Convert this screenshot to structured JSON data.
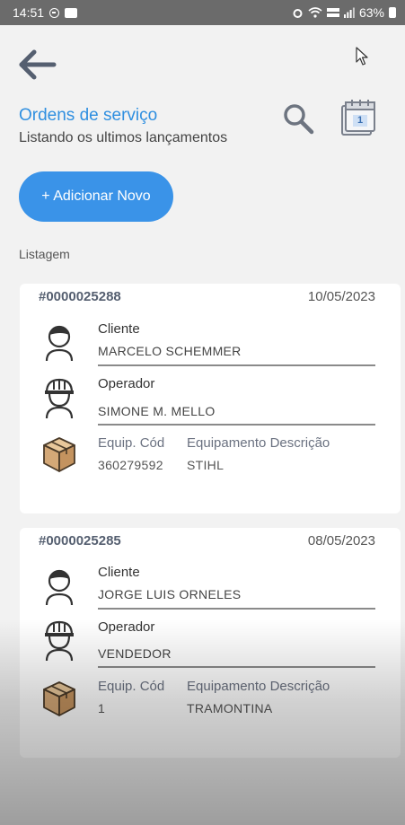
{
  "status_bar": {
    "time": "14:51",
    "battery": "63%"
  },
  "header": {
    "title": "Ordens de serviço",
    "subtitle": "Listando os ultimos lançamentos",
    "back_icon": "arrow-left-icon",
    "search_icon": "search-icon",
    "calendar_icon": "calendar-icon",
    "calendar_day": "1"
  },
  "add_button": {
    "label": "+ Adicionar Novo"
  },
  "list": {
    "label": "Listagem",
    "orders": [
      {
        "number": "#0000025288",
        "date": "10/05/2023",
        "client_label": "Cliente",
        "client": "MARCELO SCHEMMER",
        "operator_label": "Operador",
        "operator": "SIMONE M. MELLO",
        "equip_code_label": "Equip. Cód",
        "equip_desc_label": "Equipamento Descrição",
        "equip_code": "360279592",
        "equip_desc": "STIHL"
      },
      {
        "number": "#0000025285",
        "date": "08/05/2023",
        "client_label": "Cliente",
        "client": "JORGE LUIS ORNELES",
        "operator_label": "Operador",
        "operator": "VENDEDOR",
        "equip_code_label": "Equip. Cód",
        "equip_desc_label": "Equipamento Descrição",
        "equip_code": "1",
        "equip_desc": "TRAMONTINA"
      }
    ]
  },
  "colors": {
    "accent": "#3a93e8",
    "title": "#2f8fe0",
    "status_bar": "#6b6b6b"
  }
}
